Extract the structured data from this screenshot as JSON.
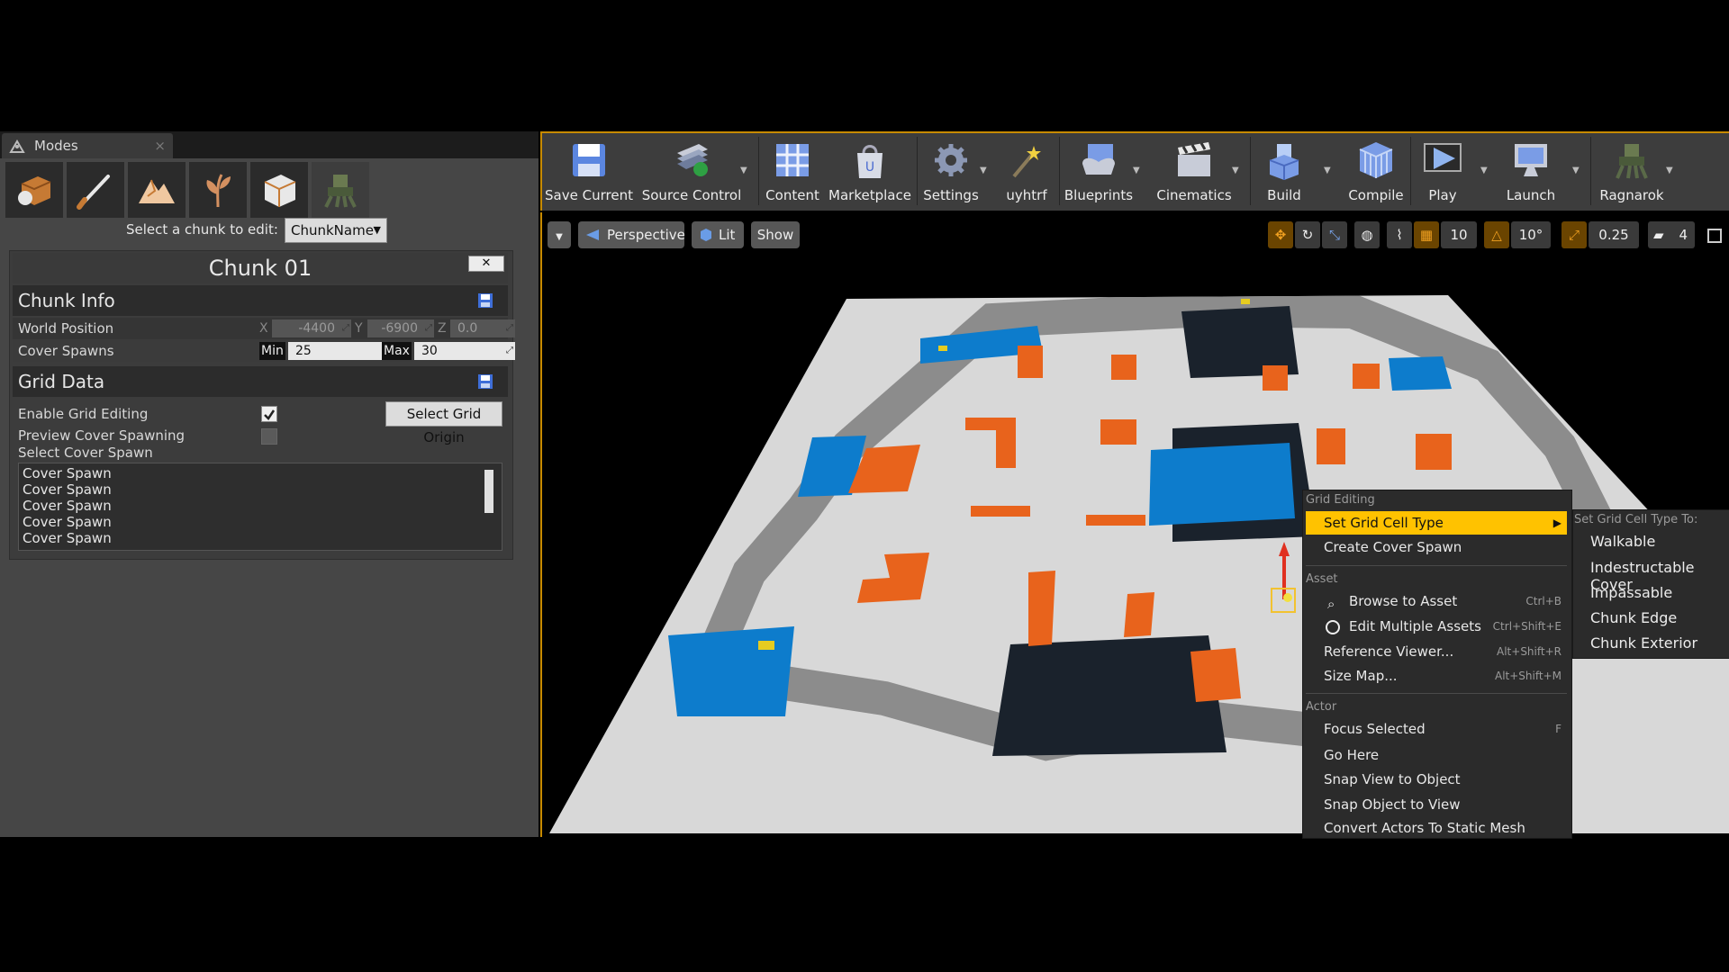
{
  "modes": {
    "tab_title": "Modes",
    "tab_close": "×",
    "select_chunk_label": "Select a chunk to edit:",
    "chunk_select_value": "ChunkName",
    "chunk_title": "Chunk 01",
    "chunk_close": "✕",
    "chunk_info": {
      "header": "Chunk Info",
      "world_position_label": "World Position",
      "x_axis": "X",
      "x_value": "-4400",
      "y_axis": "Y",
      "y_value": "-6900",
      "z_axis": "Z",
      "z_value": "0.0",
      "cover_spawns_label": "Cover Spawns",
      "min_label": "Min",
      "min_value": "25",
      "max_label": "Max",
      "max_value": "30"
    },
    "grid_data": {
      "header": "Grid Data",
      "enable_grid_editing_label": "Enable Grid Editing",
      "enable_grid_editing_checked": true,
      "select_grid_origin_button": "Select Grid Origin",
      "preview_cover_spawning_label": "Preview Cover Spawning",
      "preview_cover_spawning_checked": false,
      "select_cover_spawn_label": "Select Cover Spawn",
      "cover_spawn_list": [
        "Cover Spawn",
        "Cover Spawn",
        "Cover Spawn",
        "Cover Spawn",
        "Cover Spawn"
      ]
    }
  },
  "toolbar": {
    "buttons": [
      {
        "label": "Save Current",
        "icon": "save-icon"
      },
      {
        "label": "Source Control",
        "icon": "source-control-icon"
      },
      {
        "label": "Content",
        "icon": "content-icon"
      },
      {
        "label": "Marketplace",
        "icon": "marketplace-icon"
      },
      {
        "label": "Settings",
        "icon": "settings-icon"
      },
      {
        "label": "uyhtrf",
        "icon": "wand-icon"
      },
      {
        "label": "Blueprints",
        "icon": "blueprints-icon"
      },
      {
        "label": "Cinematics",
        "icon": "cinematics-icon"
      },
      {
        "label": "Build",
        "icon": "build-icon"
      },
      {
        "label": "Compile",
        "icon": "compile-icon"
      },
      {
        "label": "Play",
        "icon": "play-icon"
      },
      {
        "label": "Launch",
        "icon": "launch-icon"
      },
      {
        "label": "Ragnarok",
        "icon": "ragnarok-icon"
      }
    ]
  },
  "viewport": {
    "perspective": "Perspective",
    "lit": "Lit",
    "show": "Show",
    "grid_snap": "10",
    "rotation_snap": "10°",
    "scale_snap": "0.25",
    "camera_speed": "4"
  },
  "context_menu": {
    "section_grid": "Grid Editing",
    "set_grid_cell_type": "Set Grid Cell Type",
    "create_cover_spawn": "Create Cover Spawn",
    "section_asset": "Asset",
    "browse_to_asset": "Browse to Asset",
    "browse_shortcut": "Ctrl+B",
    "edit_multiple_assets": "Edit Multiple Assets",
    "edit_shortcut": "Ctrl+Shift+E",
    "reference_viewer": "Reference Viewer...",
    "reference_shortcut": "Alt+Shift+R",
    "size_map": "Size Map...",
    "size_shortcut": "Alt+Shift+M",
    "section_actor": "Actor",
    "focus_selected": "Focus Selected",
    "focus_shortcut": "F",
    "go_here": "Go Here",
    "snap_view_to_object": "Snap View to Object",
    "snap_object_to_view": "Snap Object to View",
    "convert_actors": "Convert Actors To Static Mesh"
  },
  "submenu": {
    "title": "Set Grid Cell Type To:",
    "items": [
      "Walkable",
      "Indestructable Cover",
      "Impassable",
      "Chunk Edge",
      "Chunk Exterior"
    ]
  },
  "colors": {
    "accent": "#ffc200",
    "panel": "#464646",
    "cell_orange": "#e8631c",
    "cell_blue": "#0d7ccc",
    "cell_dark": "#1a222c",
    "cell_gray": "#8c8c8c",
    "cell_floor": "#d8d8d8"
  }
}
